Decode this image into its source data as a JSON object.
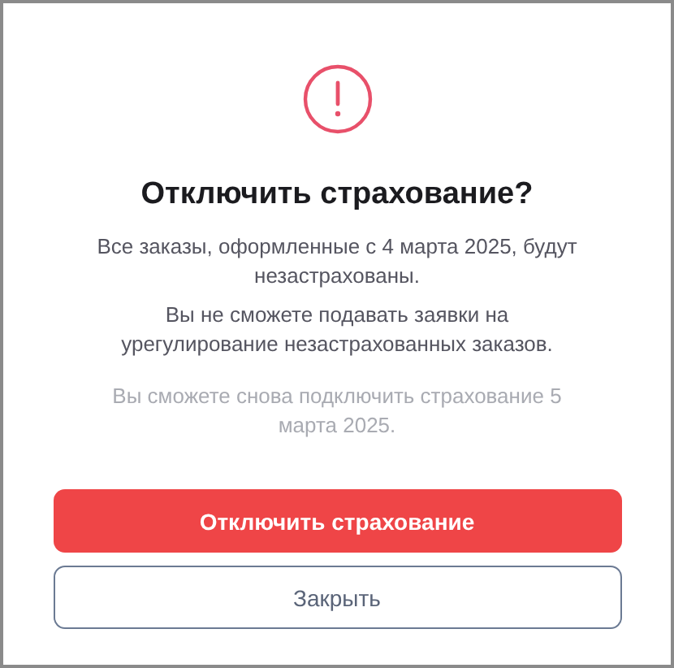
{
  "dialog": {
    "title": "Отключить страхование?",
    "paragraphs": [
      {
        "kind": "normal",
        "text": "Все заказы, оформленные с 4 марта 2025, будут незастрахованы."
      },
      {
        "kind": "normal",
        "text": "Вы не сможете подавать заявки на урегулирование незастрахованных заказов."
      },
      {
        "kind": "muted",
        "text": "Вы сможете снова подключить страхование 5 марта 2025."
      }
    ],
    "buttons": [
      {
        "kind": "primary",
        "label": "Отключить страхование"
      },
      {
        "kind": "secondary",
        "label": "Закрыть"
      }
    ]
  }
}
